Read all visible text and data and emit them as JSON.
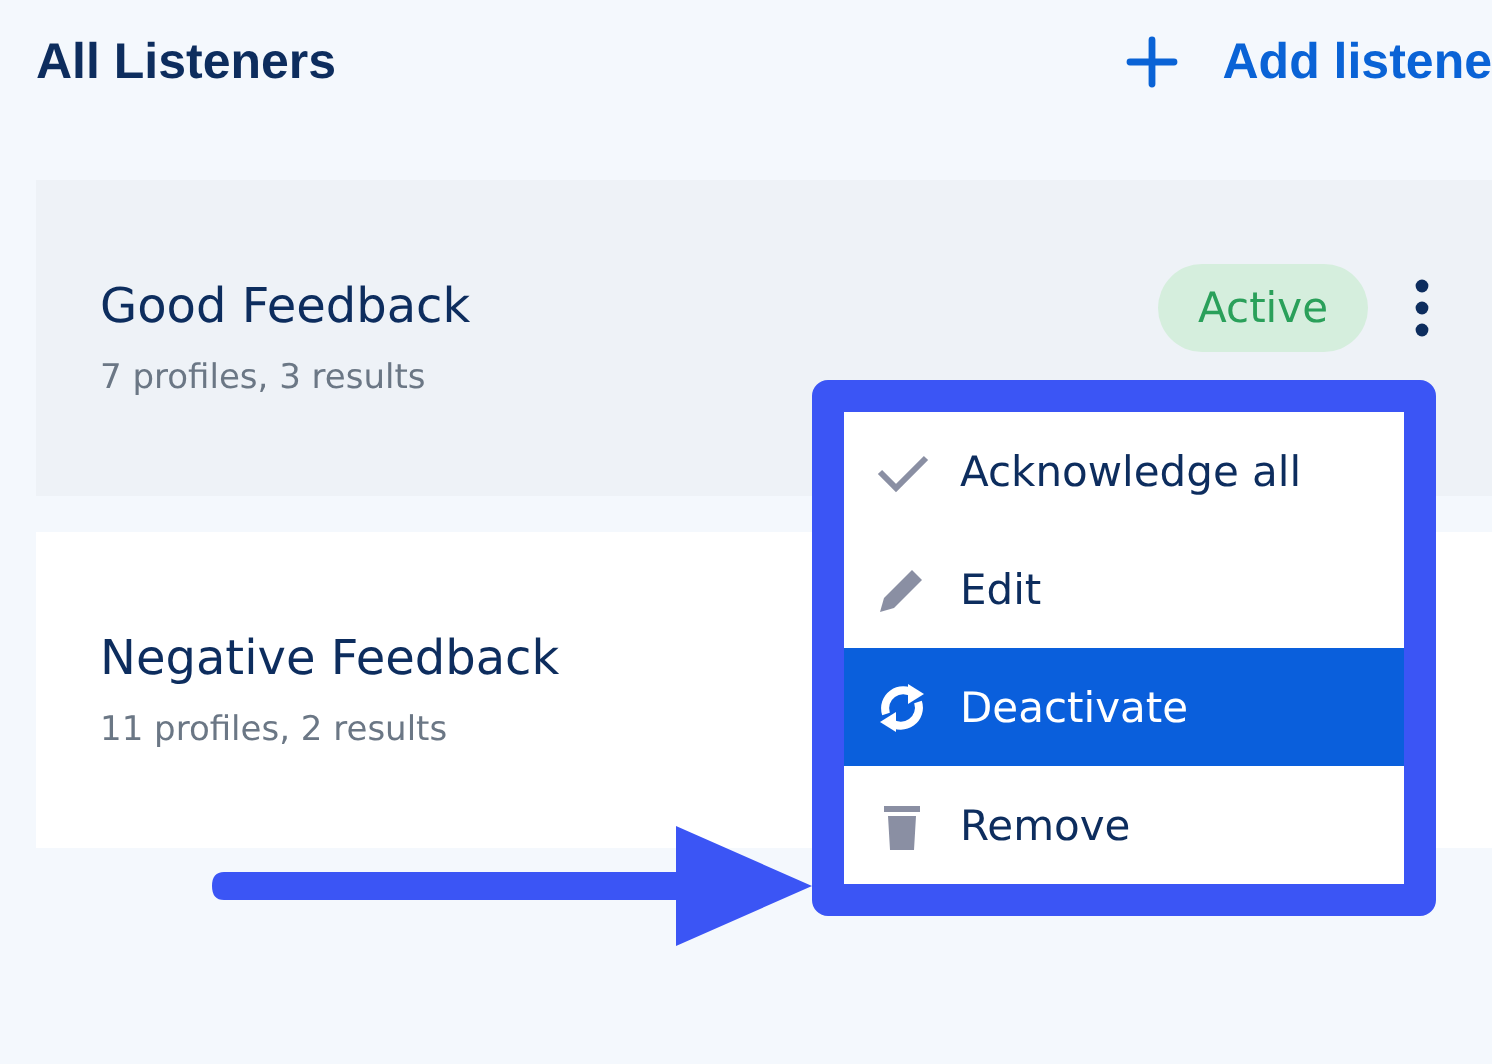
{
  "title": "All Listeners",
  "add_button": {
    "label": "Add listene"
  },
  "listeners": [
    {
      "name": "Good Feedback",
      "summary": "7 profiles, 3 results",
      "status": "Active",
      "highlighted": true
    },
    {
      "name": "Negative Feedback",
      "summary": "11 profiles, 2 results",
      "highlighted": false
    }
  ],
  "menu": {
    "items": [
      {
        "label": "Acknowledge all",
        "kind": "check",
        "selected": false
      },
      {
        "label": "Edit",
        "kind": "pencil",
        "selected": false
      },
      {
        "label": "Deactivate",
        "kind": "sync",
        "selected": true
      },
      {
        "label": "Remove",
        "kind": "trash",
        "selected": false
      }
    ]
  }
}
